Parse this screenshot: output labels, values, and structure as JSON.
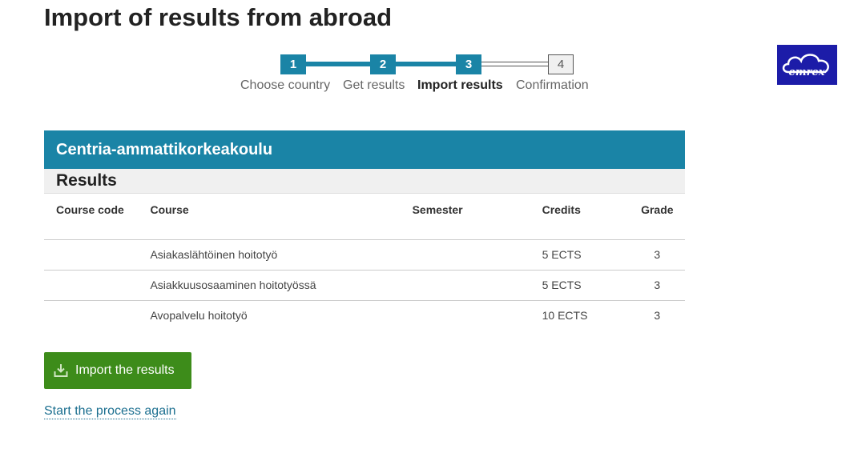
{
  "page": {
    "title": "Import of results from abroad"
  },
  "stepper": {
    "steps": [
      {
        "number": "1",
        "label": "Choose country",
        "state": "done"
      },
      {
        "number": "2",
        "label": "Get results",
        "state": "done"
      },
      {
        "number": "3",
        "label": "Import results",
        "state": "active"
      },
      {
        "number": "4",
        "label": "Confirmation",
        "state": "pending"
      }
    ]
  },
  "logo": {
    "text": "emrex"
  },
  "results": {
    "institution": "Centria-ammattikorkeakoulu",
    "heading": "Results",
    "columns": {
      "code": "Course code",
      "course": "Course",
      "semester": "Semester",
      "credits": "Credits",
      "grade": "Grade"
    },
    "rows": [
      {
        "code": "",
        "course": "Asiakaslähtöinen hoitotyö",
        "semester": "",
        "credits": "5 ECTS",
        "grade": "3"
      },
      {
        "code": "",
        "course": "Asiakkuusosaaminen hoitotyössä",
        "semester": "",
        "credits": "5 ECTS",
        "grade": "3"
      },
      {
        "code": "",
        "course": "Avopalvelu hoitotyö",
        "semester": "",
        "credits": "10 ECTS",
        "grade": "3"
      }
    ]
  },
  "actions": {
    "import_label": "Import the results",
    "import_icon": "download-icon",
    "restart_label": "Start the process again"
  },
  "colors": {
    "accent": "#1a84a6",
    "button": "#3d8c1a",
    "logo_bg": "#1c1ca8"
  }
}
